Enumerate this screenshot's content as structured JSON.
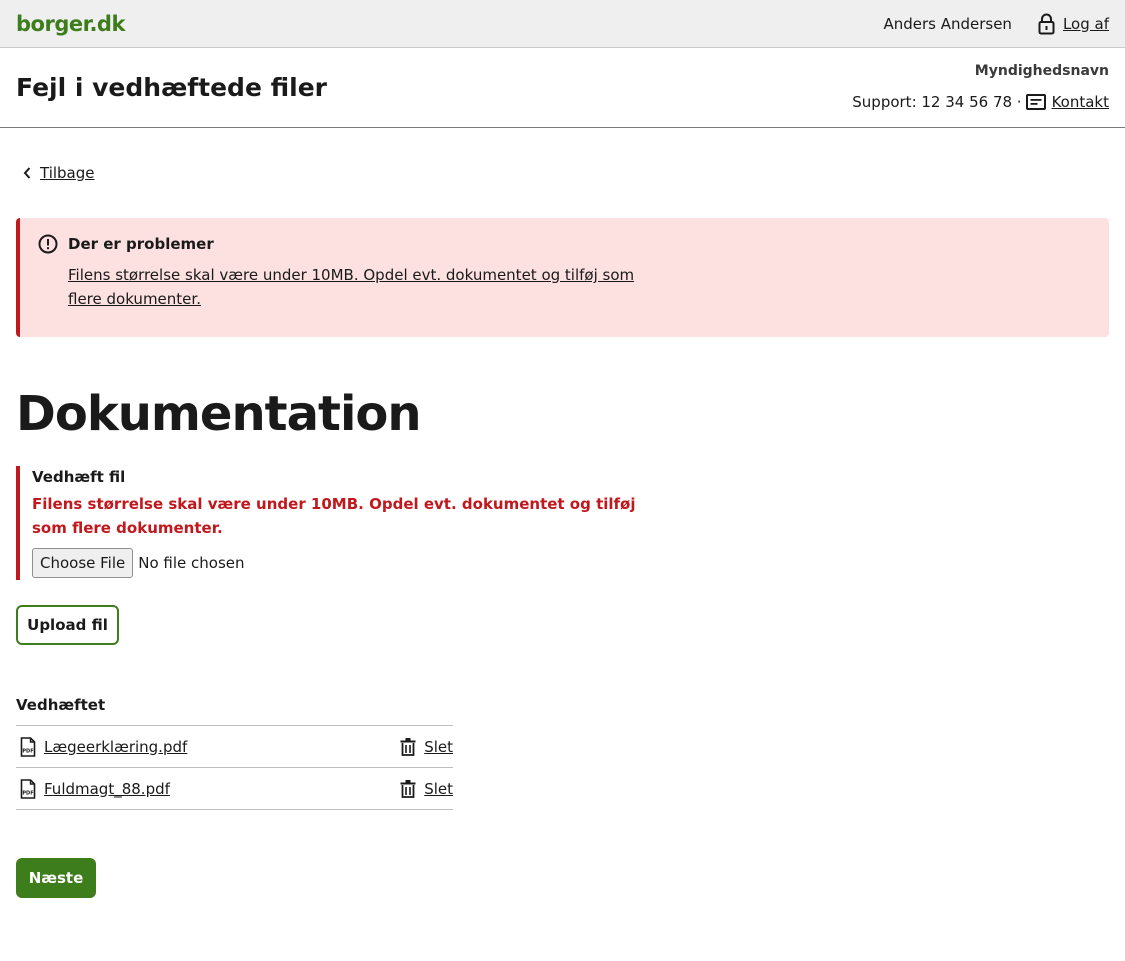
{
  "topbar": {
    "logo": "borger.dk",
    "user_name": "Anders Andersen",
    "logout_label": "Log af"
  },
  "header": {
    "title": "Fejl i vedhæftede filer",
    "authority": "Myndighedsnavn",
    "support": "Support: 12 34 56 78 ·",
    "contact_label": "Kontakt"
  },
  "back_label": "Tilbage",
  "alert": {
    "title": "Der er problemer",
    "message": "Filens størrelse skal være under 10MB. Opdel evt. dokumentet og tilføj som flere dokumenter."
  },
  "page_title": "Dokumentation",
  "upload_field": {
    "label": "Vedhæft fil",
    "error": "Filens størrelse skal være under 10MB. Opdel evt. dokumentet og tilføj som flere dokumenter.",
    "choose_label": "Choose File",
    "no_file_text": "No file chosen",
    "upload_button": "Upload fil"
  },
  "attachments": {
    "heading": "Vedhæftet",
    "delete_label": "Slet",
    "files": [
      {
        "name": "Lægeerklæring.pdf"
      },
      {
        "name": "Fuldmagt_88.pdf"
      }
    ]
  },
  "next_button": "Næste",
  "colors": {
    "brand_green": "#3d7d1c",
    "error_red": "#c0181c",
    "alert_bg": "#fde0e0"
  },
  "icons": [
    "lock-icon",
    "contact-card-icon",
    "chevron-left-icon",
    "exclamation-circle-icon",
    "pdf-file-icon",
    "trash-icon"
  ]
}
